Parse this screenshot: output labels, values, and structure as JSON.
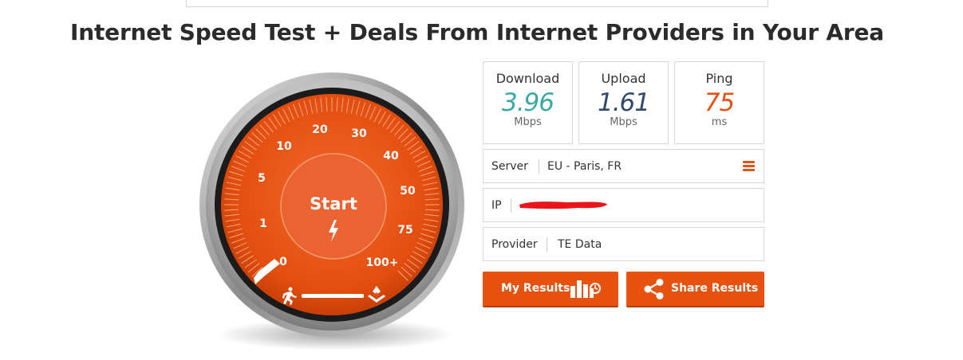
{
  "headline": {
    "bold": "Internet Speed Test",
    "rest": " + Deals From Internet Providers in Your Area"
  },
  "gauge": {
    "start_label": "Start",
    "scale_labels": [
      "0",
      "1",
      "5",
      "10",
      "20",
      "30",
      "40",
      "50",
      "75",
      "100+"
    ],
    "accent": "#e8520f",
    "icons": [
      "lightning-icon",
      "runner-icon",
      "layers-icon"
    ]
  },
  "stats": {
    "download": {
      "title": "Download",
      "value": "3.96",
      "unit": "Mbps",
      "color": "#3aa9a3"
    },
    "upload": {
      "title": "Upload",
      "value": "1.61",
      "unit": "Mbps",
      "color": "#2f4a6d"
    },
    "ping": {
      "title": "Ping",
      "value": "75",
      "unit": "ms",
      "color": "#e45314"
    }
  },
  "info": {
    "server_label": "Server",
    "server_value": "EU - Paris, FR",
    "ip_label": "IP",
    "provider_label": "Provider",
    "provider_value": "TE Data"
  },
  "buttons": {
    "my_results": "My Results",
    "share_results": "Share Results"
  }
}
